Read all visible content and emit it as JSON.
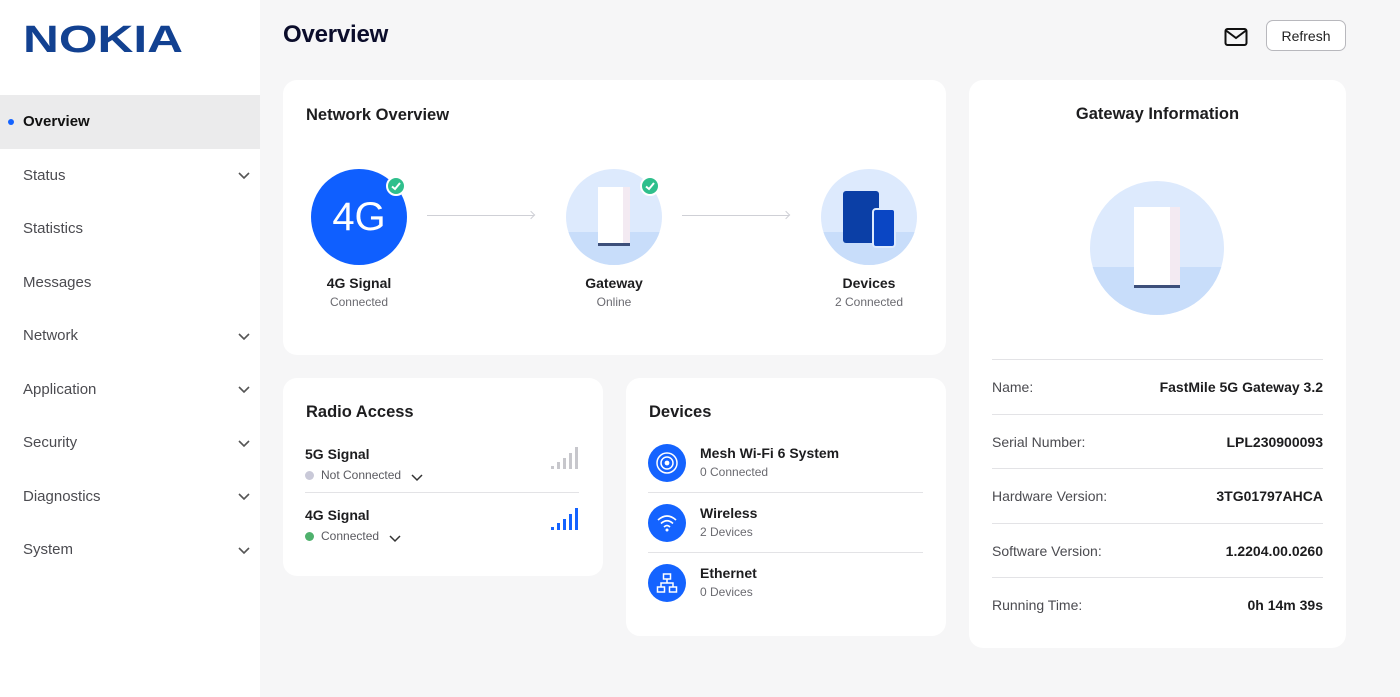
{
  "brand": {
    "logo_text": "NOKIA",
    "color": "#124191"
  },
  "sidebar": {
    "items": [
      {
        "label": "Overview",
        "active": true,
        "expandable": false
      },
      {
        "label": "Status",
        "active": false,
        "expandable": true
      },
      {
        "label": "Statistics",
        "active": false,
        "expandable": false
      },
      {
        "label": "Messages",
        "active": false,
        "expandable": false
      },
      {
        "label": "Network",
        "active": false,
        "expandable": true
      },
      {
        "label": "Application",
        "active": false,
        "expandable": true
      },
      {
        "label": "Security",
        "active": false,
        "expandable": true
      },
      {
        "label": "Diagnostics",
        "active": false,
        "expandable": true
      },
      {
        "label": "System",
        "active": false,
        "expandable": true
      }
    ]
  },
  "header": {
    "title": "Overview",
    "refresh_label": "Refresh",
    "mail_icon": "mail-icon"
  },
  "network_overview": {
    "title": "Network Overview",
    "nodes": [
      {
        "badge": "4G",
        "label": "4G Signal",
        "status": "Connected",
        "ok": true
      },
      {
        "label": "Gateway",
        "status": "Online",
        "ok": true
      },
      {
        "label": "Devices",
        "status": "2 Connected",
        "ok": false
      }
    ]
  },
  "radio_access": {
    "title": "Radio Access",
    "signals": [
      {
        "name": "5G Signal",
        "status": "Not Connected",
        "status_color": "#c9c9d8",
        "level": 0
      },
      {
        "name": "4G Signal",
        "status": "Connected",
        "status_color": "#4fb16d",
        "level": 5
      }
    ]
  },
  "devices": {
    "title": "Devices",
    "items": [
      {
        "name": "Mesh Wi-Fi 6 System",
        "sub": "0 Connected",
        "icon": "mesh-icon"
      },
      {
        "name": "Wireless",
        "sub": "2 Devices",
        "icon": "wifi-icon"
      },
      {
        "name": "Ethernet",
        "sub": "0 Devices",
        "icon": "ethernet-icon"
      }
    ]
  },
  "gateway_info": {
    "title": "Gateway Information",
    "rows": [
      {
        "key": "Name:",
        "value": "FastMile 5G Gateway 3.2"
      },
      {
        "key": "Serial Number:",
        "value": "LPL230900093"
      },
      {
        "key": "Hardware Version:",
        "value": "3TG01797AHCA"
      },
      {
        "key": "Software Version:",
        "value": "1.2204.00.0260"
      },
      {
        "key": "Running Time:",
        "value": "0h 14m 39s"
      }
    ]
  },
  "colors": {
    "accent": "#1463ff",
    "success": "#2fbf8c",
    "background": "#f6f6f7"
  }
}
